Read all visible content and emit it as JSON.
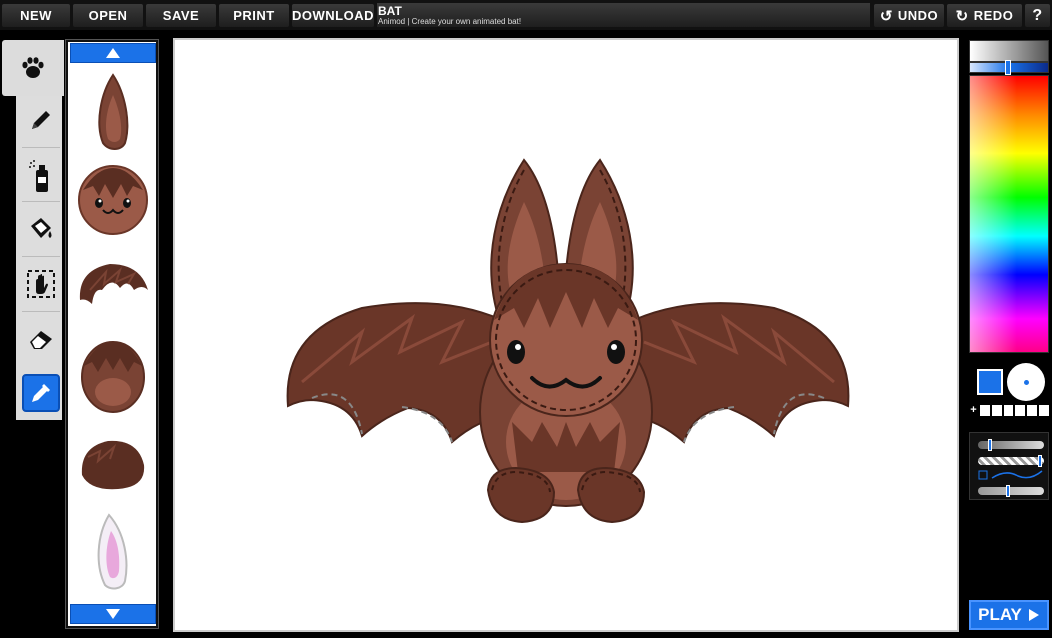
{
  "toolbar": {
    "new_label": "NEW",
    "open_label": "OPEN",
    "save_label": "SAVE",
    "print_label": "PRINT",
    "download_label": "DOWNLOAD",
    "undo_label": "UNDO",
    "redo_label": "REDO",
    "help_label": "?"
  },
  "document": {
    "title": "BAT",
    "subtitle": "Animod | Create your own animated bat!"
  },
  "tools": [
    {
      "icon": "paw-icon"
    },
    {
      "icon": "pencil-icon"
    },
    {
      "icon": "spray-can-icon"
    },
    {
      "icon": "paint-bucket-icon"
    },
    {
      "icon": "hand-select-icon"
    },
    {
      "icon": "eraser-icon"
    },
    {
      "icon": "eyedropper-icon"
    }
  ],
  "parts": [
    {
      "icon": "bat-ear-part"
    },
    {
      "icon": "bat-head-part"
    },
    {
      "icon": "bat-wing-part"
    },
    {
      "icon": "bat-body-part"
    },
    {
      "icon": "bat-foot-part"
    },
    {
      "icon": "bunny-ear-part"
    }
  ],
  "colors": {
    "accent": "#1b72e8",
    "current_color": "#1b72e8",
    "bat_dark": "#5a2e22",
    "bat_mid": "#7a4334",
    "bat_light": "#9b5a48"
  },
  "play_label": "PLAY"
}
